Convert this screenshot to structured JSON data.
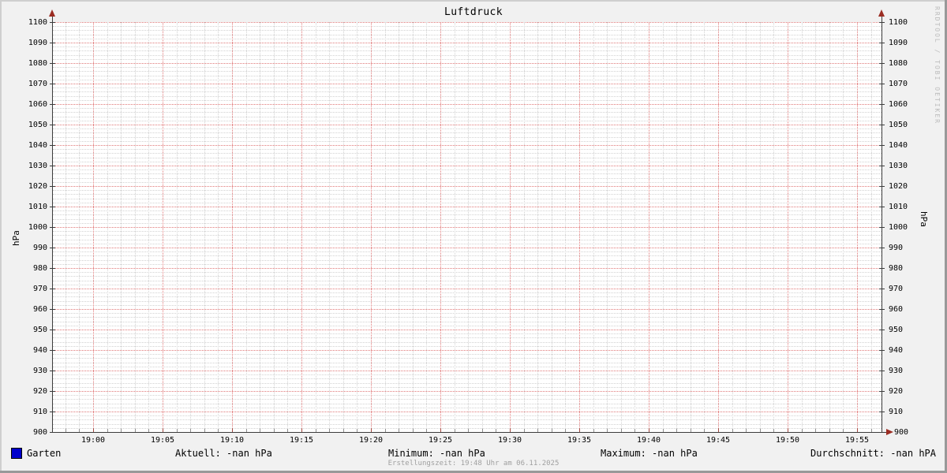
{
  "colors": {
    "background": "#f1f1f1",
    "canvas": "#ffffff",
    "grid_minor": "#d2d2d2",
    "grid_major": "#e07878",
    "axis": "#3c3c3c",
    "axis_arrow": "#9b2d23",
    "bevel_light": "#cfcfcf",
    "bevel_dark": "#999999",
    "watermark_text": "#bcbcbc",
    "footer_text": "#a0a0a0",
    "series_garten": "#0000cc"
  },
  "watermark": "RRDTOOL / TOBI OETIKER",
  "footer": "Erstellungszeit: 19:48 Uhr am 06.11.2025",
  "stats": {
    "aktuell": "Aktuell: -nan hPa",
    "minimum": "Minimum: -nan hPa",
    "maximum": "Maximum: -nan hPa",
    "durchschnitt": "Durchschnitt: -nan hPA"
  },
  "chart_data": {
    "type": "line",
    "title": "Luftdruck",
    "ylabel": "hPa",
    "ylabel_right": "hPa",
    "ylim": [
      900,
      1100
    ],
    "y_tick_step": 10,
    "y_minor_step": 2,
    "y_ticks": [
      900,
      910,
      920,
      930,
      940,
      950,
      960,
      970,
      980,
      990,
      1000,
      1010,
      1020,
      1030,
      1040,
      1050,
      1060,
      1070,
      1080,
      1090,
      1100
    ],
    "x_ticks": [
      "19:00",
      "19:05",
      "19:10",
      "19:15",
      "19:20",
      "19:25",
      "19:30",
      "19:35",
      "19:40",
      "19:45",
      "19:50",
      "19:55"
    ],
    "x_minor_per_major": 5,
    "grid": true,
    "legend_position": "bottom",
    "series": [
      {
        "name": "Garten",
        "color": "#0000cc",
        "values": []
      }
    ],
    "no_data": true
  }
}
